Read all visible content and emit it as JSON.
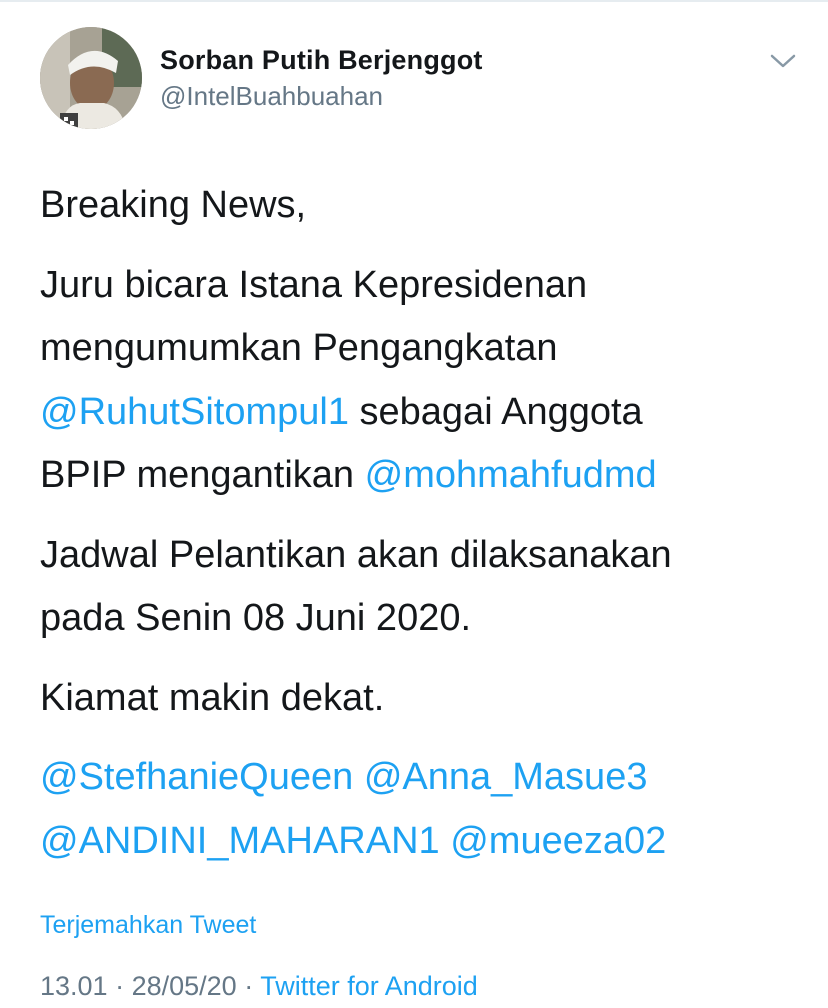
{
  "tweet": {
    "author": {
      "display_name": "Sorban Putih Berjenggot",
      "handle": "@IntelBuahbuahan",
      "avatar": "avatar-photo"
    },
    "menu_icon": "chevron-down-icon",
    "body": {
      "p1": "Breaking News,",
      "p2_line1": "Juru bicara Istana Kepresidenan",
      "p2_line2": "mengumumkan Pengangkatan",
      "p2_mention1": "@RuhutSitompul1",
      "p2_line3_rest": " sebagai Anggota",
      "p2_line4_start": "BPIP mengantikan ",
      "p2_mention2": "@mohmahfudmd",
      "p3_line1": "Jadwal Pelantikan akan dilaksanakan",
      "p3_line2": "pada Senin 08 Juni 2020.",
      "p4": "Kiamat makin dekat.",
      "mentions": [
        "@StefhanieQueen",
        "@Anna_Masue3",
        "@ANDINI_MAHARAN1",
        "@mueeza02"
      ]
    },
    "translate_label": "Terjemahkan Tweet",
    "time": "13.01",
    "date": "28/05/20",
    "separator": " · ",
    "source": "Twitter for Android"
  },
  "colors": {
    "link": "#1da1f2",
    "text": "#14171a",
    "muted": "#657786"
  }
}
